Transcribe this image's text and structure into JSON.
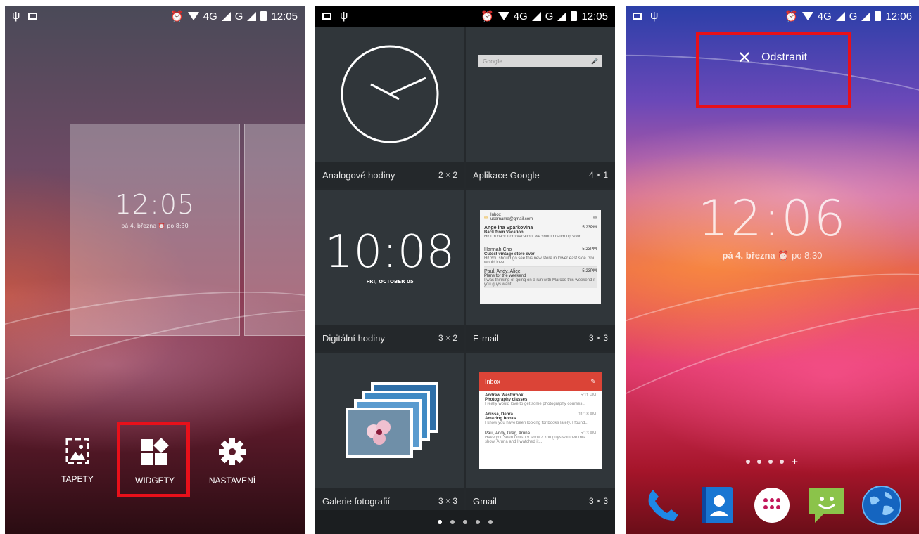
{
  "screen1": {
    "status": {
      "time": "12:05",
      "network1": "4G",
      "network2": "G"
    },
    "preview_clock": {
      "time": "12:05",
      "date": "pá 4. března",
      "alarm": "po 8:30"
    },
    "menu": [
      {
        "label": "TAPETY",
        "icon": "wallpaper-icon"
      },
      {
        "label": "WIDGETY",
        "icon": "widgets-icon"
      },
      {
        "label": "NASTAVENÍ",
        "icon": "gear-icon"
      }
    ],
    "highlight_color": "#e8101a"
  },
  "screen2": {
    "status": {
      "time": "12:05",
      "network1": "4G",
      "network2": "G"
    },
    "widgets": [
      {
        "name": "Analogové hodiny",
        "size": "2 × 2"
      },
      {
        "name": "Aplikace Google",
        "size": "4 × 1"
      },
      {
        "name": "Digitální hodiny",
        "size": "3 × 2"
      },
      {
        "name": "E-mail",
        "size": "3 × 3"
      },
      {
        "name": "Galerie fotografií",
        "size": "3 × 3"
      },
      {
        "name": "Gmail",
        "size": "3 × 3"
      }
    ],
    "google_bar_text": "Google",
    "digital_clock": {
      "time": "10:08",
      "date": "FRI, OCTOBER 05"
    },
    "email_preview": {
      "header": "Inbox",
      "account": "username@gmail.com",
      "items": [
        {
          "from": "Angelina Sparkovina",
          "subject": "Back from Vacation",
          "snippet": "Hi! I'm back from vacation, we should catch up soon.",
          "time": "5:23PM"
        },
        {
          "from": "Hannah Cho",
          "subject": "Cutest vintage store ever",
          "snippet": "Hi! You should go see this new store in lower east side. You would love...",
          "time": "5:23PM"
        },
        {
          "from": "Paul, Andy, Alice",
          "subject": "Plans for the weekend",
          "snippet": "I was thinking of going on a run with Marcos this weekend if you guys want...",
          "time": "5:23PM"
        }
      ]
    },
    "gmail_preview": {
      "header": "Inbox",
      "items": [
        {
          "from": "Andrew Westbrook",
          "subject": "Photography classes",
          "snippet": "I really would love to get some photography courses...",
          "time": "5:11 PM"
        },
        {
          "from": "Anissa, Debra",
          "subject": "Amazing books",
          "snippet": "I know you have been looking for books lately. I found...",
          "time": "11:18 AM"
        },
        {
          "from": "Paul, Andy, Greg, Aruna",
          "subject": "",
          "snippet": "Have you seen Grits TV show? You guys will love this show. Aruna and I watched it...",
          "time": "5:13 AM"
        }
      ]
    },
    "page_count": 5
  },
  "screen3": {
    "status": {
      "time": "12:06",
      "network1": "4G",
      "network2": "G"
    },
    "remove_label": "Odstranit",
    "clock": {
      "time": "12:06",
      "date": "pá 4. března",
      "alarm": "po 8:30"
    },
    "home_pages_plus": "+",
    "dock": [
      {
        "name": "phone-icon",
        "color": "#1e88e5"
      },
      {
        "name": "contacts-icon",
        "color": "#1976d2"
      },
      {
        "name": "apps-drawer-icon",
        "color": "#ffffff"
      },
      {
        "name": "messaging-icon",
        "color": "#8bc34a"
      },
      {
        "name": "browser-icon",
        "color": "#1565c0"
      }
    ]
  }
}
